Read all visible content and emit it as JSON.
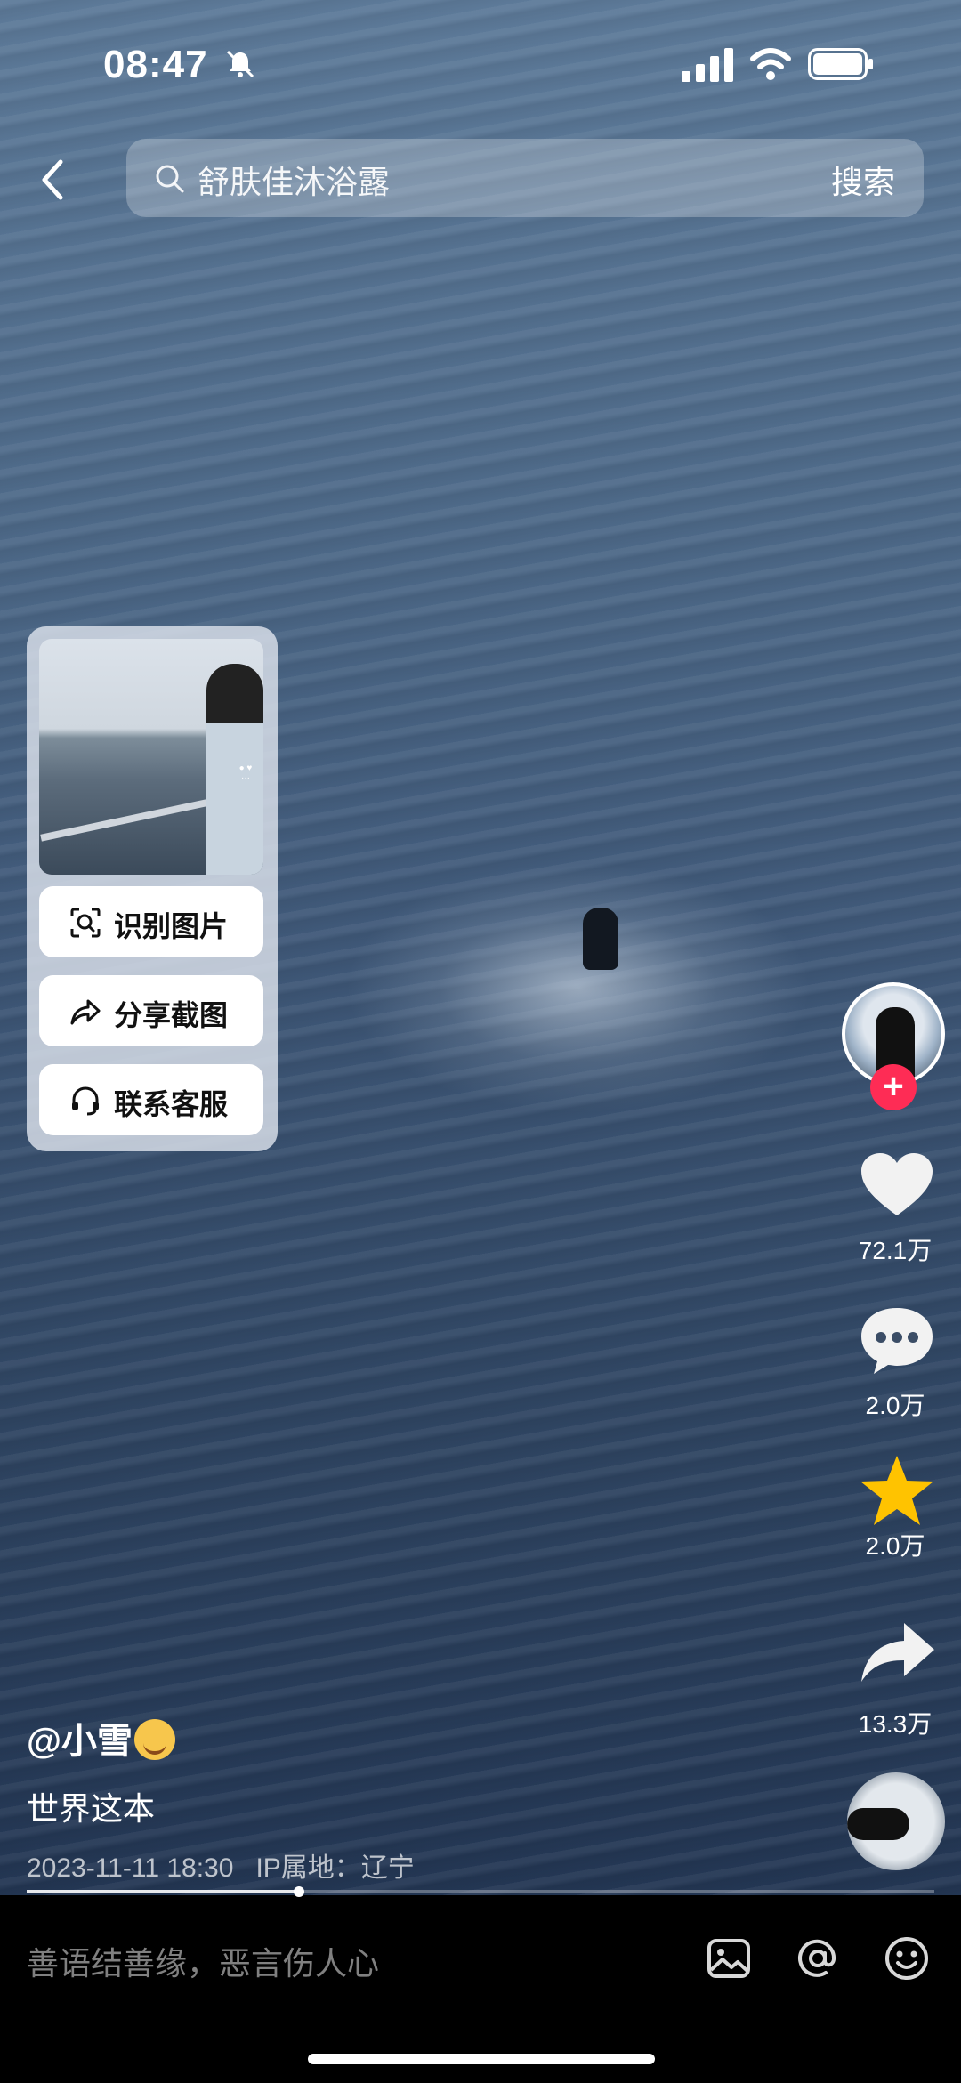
{
  "status_bar": {
    "time": "08:47",
    "icons": [
      "bell-slash-icon",
      "signal-icon",
      "wifi-icon",
      "battery-icon"
    ]
  },
  "search": {
    "query": "舒肤佳沐浴露",
    "button": "搜索"
  },
  "popup": {
    "menu": [
      {
        "label": "识别图片",
        "icon": "image-scan-icon"
      },
      {
        "label": "分享截图",
        "icon": "share-icon"
      },
      {
        "label": "联系客服",
        "icon": "headset-icon"
      }
    ]
  },
  "rail": {
    "likes": "72.1万",
    "comments": "2.0万",
    "favorites": "2.0万",
    "shares": "13.3万"
  },
  "post": {
    "author": "@小雪",
    "caption": "世界这本",
    "date": "2023-11-11 18:30",
    "ip": "IP属地：辽宁",
    "progress": 0.3
  },
  "bottom": {
    "placeholder": "善语结善缘，恶言伤人心"
  },
  "colors": {
    "accent": "#fe2c55",
    "star": "#ffc300"
  }
}
